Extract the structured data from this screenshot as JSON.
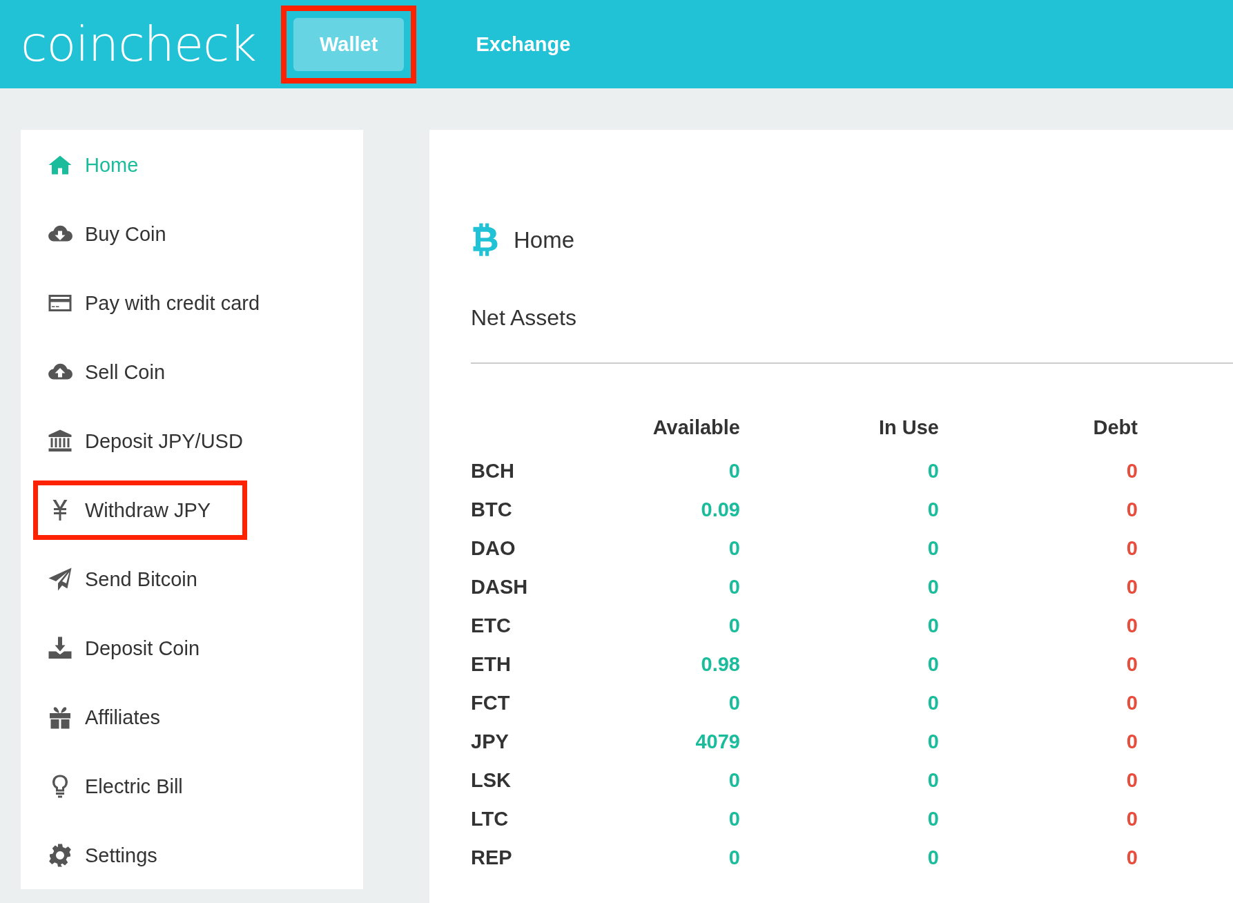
{
  "header": {
    "logo": "coincheck",
    "tabs": [
      {
        "label": "Wallet",
        "selected": true,
        "highlighted": true
      },
      {
        "label": "Exchange",
        "selected": false,
        "highlighted": false
      }
    ]
  },
  "sidebar": {
    "items": [
      {
        "label": "Home",
        "selected": true,
        "highlighted": false
      },
      {
        "label": "Buy Coin",
        "selected": false,
        "highlighted": false
      },
      {
        "label": "Pay with credit card",
        "selected": false,
        "highlighted": false
      },
      {
        "label": "Sell Coin",
        "selected": false,
        "highlighted": false
      },
      {
        "label": "Deposit JPY/USD",
        "selected": false,
        "highlighted": false
      },
      {
        "label": "Withdraw JPY",
        "selected": false,
        "highlighted": true
      },
      {
        "label": "Send Bitcoin",
        "selected": false,
        "highlighted": false
      },
      {
        "label": "Deposit Coin",
        "selected": false,
        "highlighted": false
      },
      {
        "label": "Affiliates",
        "selected": false,
        "highlighted": false
      },
      {
        "label": "Electric Bill",
        "selected": false,
        "highlighted": false
      },
      {
        "label": "Settings",
        "selected": false,
        "highlighted": false
      }
    ]
  },
  "main": {
    "title": "Home",
    "section": "Net Assets",
    "table": {
      "columns": [
        "",
        "Available",
        "In Use",
        "Debt"
      ],
      "rows": [
        [
          "BCH",
          "0",
          "0",
          "0"
        ],
        [
          "BTC",
          "0.09",
          "0",
          "0"
        ],
        [
          "DAO",
          "0",
          "0",
          "0"
        ],
        [
          "DASH",
          "0",
          "0",
          "0"
        ],
        [
          "ETC",
          "0",
          "0",
          "0"
        ],
        [
          "ETH",
          "0.98",
          "0",
          "0"
        ],
        [
          "FCT",
          "0",
          "0",
          "0"
        ],
        [
          "JPY",
          "4079",
          "0",
          "0"
        ],
        [
          "LSK",
          "0",
          "0",
          "0"
        ],
        [
          "LTC",
          "0",
          "0",
          "0"
        ],
        [
          "REP",
          "0",
          "0",
          "0"
        ]
      ]
    }
  }
}
